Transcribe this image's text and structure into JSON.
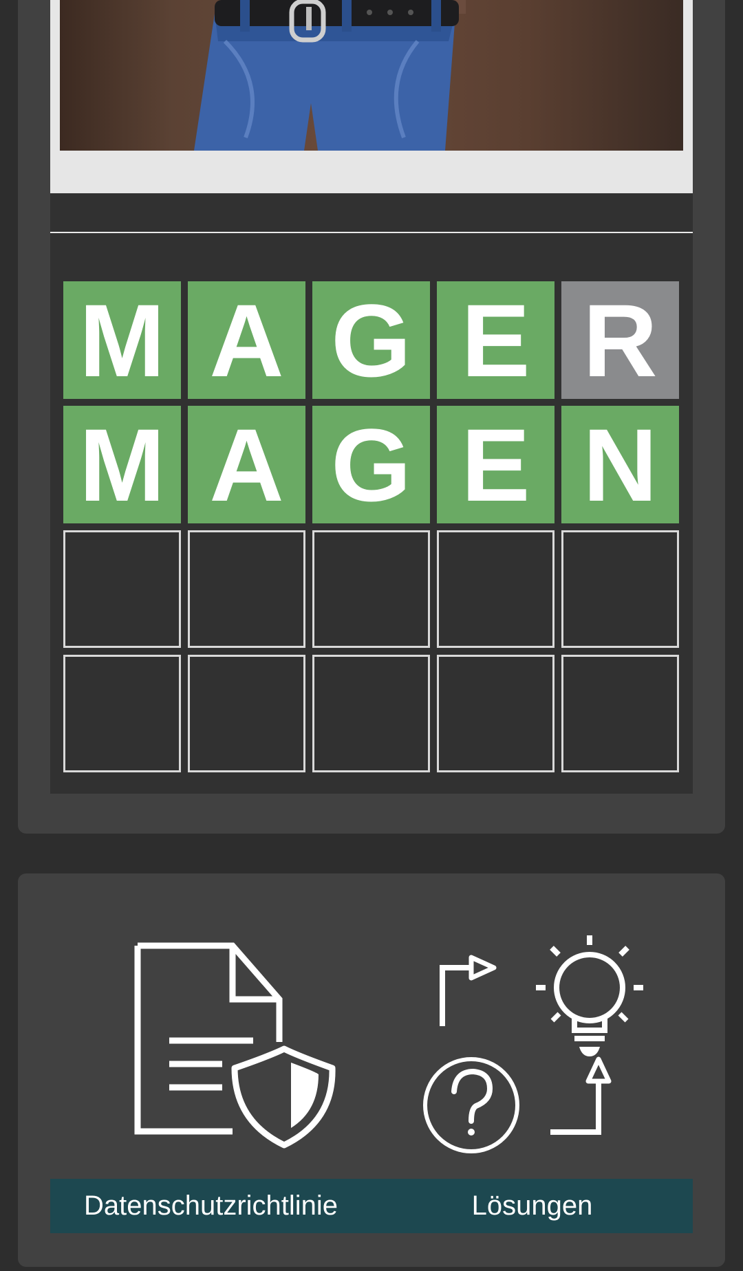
{
  "app": {
    "accent_correct": "#6aaa64",
    "accent_absent": "#8a8b8d",
    "background": "#2d2d2d",
    "card_background": "#414141",
    "label_bar_color": "#1d4850"
  },
  "photo": {
    "icon": "person-photo"
  },
  "board": {
    "rows": [
      [
        {
          "letter": "M",
          "state": "correct"
        },
        {
          "letter": "A",
          "state": "correct"
        },
        {
          "letter": "G",
          "state": "correct"
        },
        {
          "letter": "E",
          "state": "correct"
        },
        {
          "letter": "R",
          "state": "absent"
        }
      ],
      [
        {
          "letter": "M",
          "state": "correct"
        },
        {
          "letter": "A",
          "state": "correct"
        },
        {
          "letter": "G",
          "state": "correct"
        },
        {
          "letter": "E",
          "state": "correct"
        },
        {
          "letter": "N",
          "state": "correct"
        }
      ],
      [
        {
          "letter": "",
          "state": "empty"
        },
        {
          "letter": "",
          "state": "empty"
        },
        {
          "letter": "",
          "state": "empty"
        },
        {
          "letter": "",
          "state": "empty"
        },
        {
          "letter": "",
          "state": "empty"
        }
      ],
      [
        {
          "letter": "",
          "state": "empty"
        },
        {
          "letter": "",
          "state": "empty"
        },
        {
          "letter": "",
          "state": "empty"
        },
        {
          "letter": "",
          "state": "empty"
        },
        {
          "letter": "",
          "state": "empty"
        }
      ]
    ]
  },
  "menu": {
    "privacy_label": "Datenschutzrichtlinie",
    "privacy_icon": "document-shield-icon",
    "solutions_label": "Lösungen",
    "solutions_icon": "lightbulb-question-icon"
  }
}
